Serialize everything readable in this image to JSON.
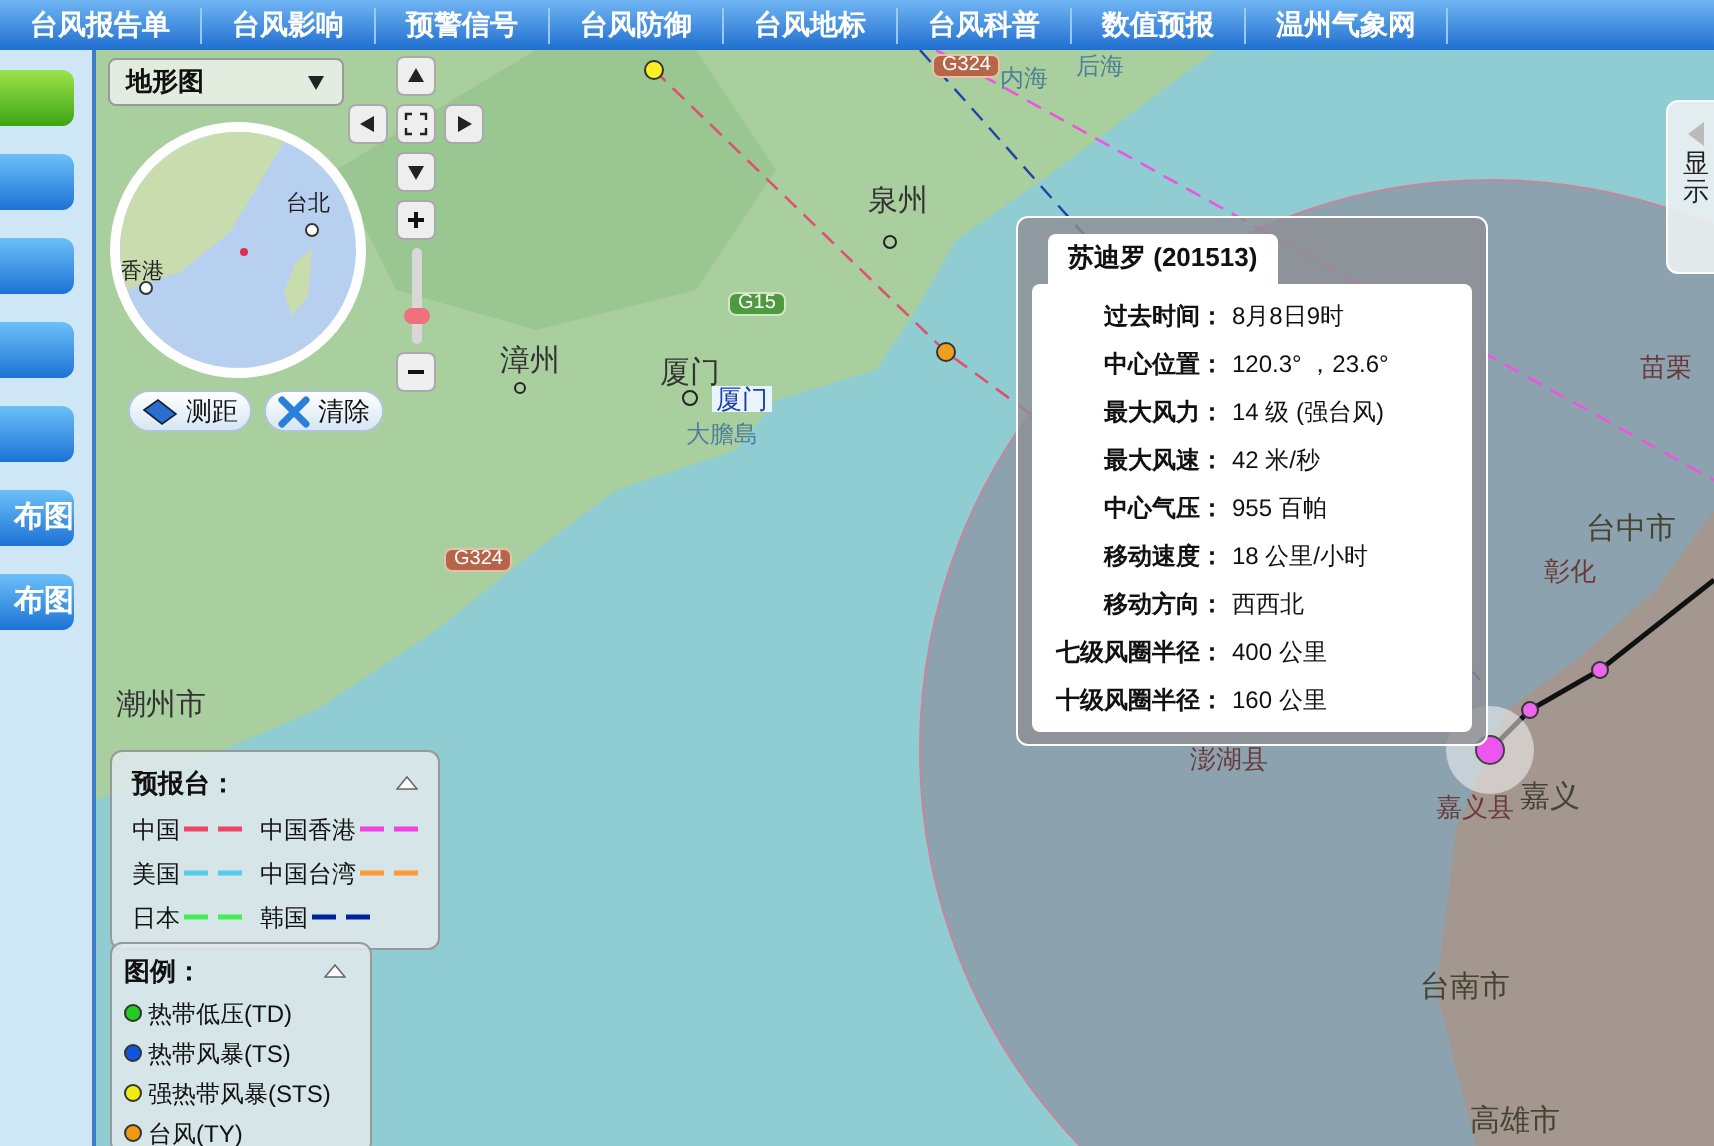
{
  "nav": [
    {
      "label": "台风报告单"
    },
    {
      "label": "台风影响"
    },
    {
      "label": "预警信号"
    },
    {
      "label": "台风防御"
    },
    {
      "label": "台风地标"
    },
    {
      "label": "台风科普"
    },
    {
      "label": "数值预报"
    },
    {
      "label": "温州气象网"
    }
  ],
  "sidebar": {
    "items": [
      {
        "selected": true
      },
      {
        "selected": false
      },
      {
        "selected": false
      },
      {
        "selected": false
      },
      {
        "selected": false
      },
      {
        "label": "布图",
        "selected": false
      },
      {
        "label": "布图",
        "selected": false
      }
    ]
  },
  "map_type": {
    "value": "地形图"
  },
  "zoom": {
    "level": 0.25
  },
  "minimap": {
    "labels": [
      "台北",
      "香港"
    ]
  },
  "tools": [
    {
      "label": "测距",
      "kind": "ruler"
    },
    {
      "label": "清除",
      "kind": "clear"
    }
  ],
  "map_labels": [
    {
      "text": "G324",
      "kind": "road_red"
    },
    {
      "text": "内海",
      "kind": "water"
    },
    {
      "text": "后海",
      "kind": "water"
    },
    {
      "text": "泉州",
      "kind": "city"
    },
    {
      "text": "G15",
      "kind": "road_green"
    },
    {
      "text": "漳州",
      "kind": "city"
    },
    {
      "text": "厦门",
      "kind": "city"
    },
    {
      "text": "厦门",
      "kind": "marker"
    },
    {
      "text": "大膽島",
      "kind": "water"
    },
    {
      "text": "G324",
      "kind": "road_red"
    },
    {
      "text": "潮州市",
      "kind": "city"
    },
    {
      "text": "澎湖县",
      "kind": "tw_small"
    },
    {
      "text": "苗栗",
      "kind": "tw_small"
    },
    {
      "text": "台中市",
      "kind": "tw_city"
    },
    {
      "text": "彰化",
      "kind": "tw_small"
    },
    {
      "text": "嘉义县",
      "kind": "tw_small"
    },
    {
      "text": "嘉义",
      "kind": "tw_city"
    },
    {
      "text": "台南市",
      "kind": "tw_city"
    },
    {
      "text": "高雄市",
      "kind": "tw_city"
    }
  ],
  "info_popup": {
    "title": "苏迪罗 (201513)",
    "rows": [
      {
        "label": "过去时间：",
        "value": "8月8日9时"
      },
      {
        "label": "中心位置：",
        "value": "120.3° ，23.6°"
      },
      {
        "label": "最大风力：",
        "value": "14 级 (强台风)"
      },
      {
        "label": "最大风速：",
        "value": "42 米/秒"
      },
      {
        "label": "中心气压：",
        "value": "955 百帕"
      },
      {
        "label": "移动速度：",
        "value": "18 公里/小时"
      },
      {
        "label": "移动方向：",
        "value": "西西北"
      },
      {
        "label": "七级风圈半径：",
        "value": "400 公里"
      },
      {
        "label": "十级风圈半径：",
        "value": "160 公里"
      }
    ]
  },
  "forecast_legend": {
    "title": "预报台：",
    "items": [
      {
        "label": "中国",
        "color": "#ee4466"
      },
      {
        "label": "中国香港",
        "color": "#ee44dd"
      },
      {
        "label": "美国",
        "color": "#55ccee"
      },
      {
        "label": "中国台湾",
        "color": "#ff9933"
      },
      {
        "label": "日本",
        "color": "#44ee55"
      },
      {
        "label": "韩国",
        "color": "#002299"
      }
    ]
  },
  "legend": {
    "title": "图例：",
    "items": [
      {
        "label": "热带低压(TD)",
        "color": "#22cc22"
      },
      {
        "label": "热带风暴(TS)",
        "color": "#1155dd"
      },
      {
        "label": "强热带风暴(STS)",
        "color": "#eeee11"
      },
      {
        "label": "台风(TY)",
        "color": "#ee9911"
      }
    ]
  },
  "side_tab": {
    "label": "显示"
  }
}
